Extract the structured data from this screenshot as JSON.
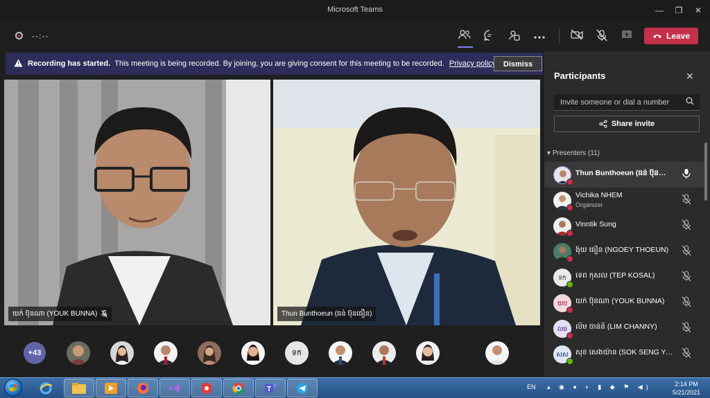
{
  "window": {
    "title": "Microsoft Teams",
    "controls": [
      "—",
      "❐",
      "✕"
    ]
  },
  "toolbar": {
    "timer": "--:--",
    "leave_label": "Leave"
  },
  "banner": {
    "bold": "Recording has started.",
    "text": "This meeting is being recorded. By joining, you are giving consent for this meeting to be recorded.",
    "link": "Privacy policy",
    "dismiss": "Dismiss"
  },
  "videos": [
    {
      "name": "យក់ ប៊ុនណា (YOUK BUNNA)"
    },
    {
      "name": "Thun Bunthoeun (ធន់ ប៊ុនធឿន)"
    }
  ],
  "strip": {
    "more_count": "+43",
    "thumbs": [
      "",
      "",
      "",
      "",
      "",
      "",
      "ទក",
      "",
      "",
      "",
      "",
      ""
    ]
  },
  "panel": {
    "title": "Participants",
    "invite_placeholder": "Invite someone or dial a number",
    "share_label": "Share invite",
    "section_label": "Presenters (11)",
    "participants": [
      {
        "name": "Thun Bunthoeun (ធន់ ប៊ុនធឿន)",
        "sub": "",
        "initials": "",
        "mic": "on",
        "status": "red"
      },
      {
        "name": "Vichika NHEM",
        "sub": "Organizer",
        "initials": "",
        "mic": "muted",
        "status": "red"
      },
      {
        "name": "Vinntik Sung",
        "sub": "",
        "initials": "",
        "mic": "muted",
        "status": "red"
      },
      {
        "name": "ង៉ុយ ធឿន (NGOEY THOEUN)",
        "sub": "",
        "initials": "",
        "mic": "muted",
        "status": "red"
      },
      {
        "name": "ទេព កុសល (TEP KOSAL)",
        "sub": "",
        "initials": "ទក",
        "mic": "muted",
        "status": "green"
      },
      {
        "name": "យក់ ប៊ុនណា (YOUK BUNNA)",
        "sub": "",
        "initials": "យប",
        "mic": "muted",
        "status": "red"
      },
      {
        "name": "លឹម ចាន់នី (LIM CHANNY)",
        "sub": "",
        "initials": "លឆ",
        "mic": "muted",
        "status": "red"
      },
      {
        "name": "សុខ សេងយ៉ាន (SOK SENG YAN)",
        "sub": "",
        "initials": "សស",
        "mic": "muted",
        "status": "green"
      }
    ]
  },
  "taskbar": {
    "apps": [
      "folder",
      "media",
      "firefox",
      "visual-studio",
      "recorder",
      "chrome",
      "teams",
      "telegram"
    ],
    "lang": "EN",
    "time": "2:14 PM",
    "date": "5/21/2021"
  },
  "colors": {
    "accent": "#6264a7",
    "leave": "#c4314b",
    "banner": "#2d2c5a"
  }
}
